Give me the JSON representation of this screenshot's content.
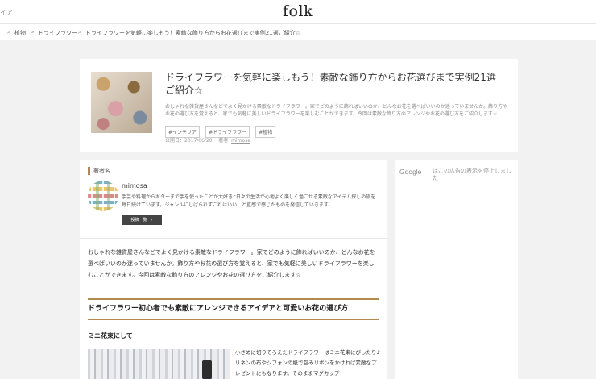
{
  "header": {
    "left_cut_text": "イア",
    "logo": "folk"
  },
  "breadcrumb": {
    "home": ">",
    "items": [
      "植物",
      "ドライフラワー",
      "ドライフラワーを気軽に楽しもう！素敵な飾り方からお花選びまで実例21選ご紹介☆"
    ],
    "separator": ">"
  },
  "article_card": {
    "title": "ドライフラワーを気軽に楽しもう！素敵な飾り方からお花選びまで実例21選ご紹介☆",
    "lead": "おしゃれな雑貨屋さんなどでよく見かける素敵なドライフラワー。家でどのように飾ればいいのか、どんなお花を選べばいいのか迷っていませんか。飾り方やお花の選び方を覚えると、家でも気軽に美しいドライフラワーを楽しむことができます。今回は素敵な飾り方のアレンジやお花の選び方をご紹介します☆",
    "tags": [
      "#インテリア",
      "#ドライフラワー",
      "#植物"
    ],
    "date_label": "公開日：2017/06/20",
    "author_label": "著者",
    "author_name": "mimosa"
  },
  "author_box": {
    "heading": "著者名",
    "name": "mimosa",
    "bio": "手芸や料理からギターまで手を使ったことが大好き♪日々の生活が心地よく楽しく過ごせる素敵なアイテム探しの旅を毎日続けています。ジャンルにしばられずこれはいい！と直感で感じたものを発信していきます。",
    "button_label": "投稿一覧",
    "button_icon": "chevron-right-icon"
  },
  "intro": "おしゃれな雑貨屋さんなどでよく見かける素敵なドライフラワー。家でどのように飾ればいいのか、どんなお花を選べばいいのか迷っていませんか。飾り方やお花の選び方を覚えると、家でも気軽に美しいドライフラワーを楽しむことができます。今回は素敵な飾り方のアレンジやお花の選び方をご紹介します☆",
  "section": {
    "h2": "ドライフラワー初心者でも素敵にアレンジできるアイデアと可愛いお花の選び方",
    "h3": "ミニ花束にして",
    "text": "小さめに切りそろえたドライフラワーはミニ花束にぴったり♪リネンの布やシフォンの紙で包みリボンをかければ素敵なプレゼントにもなります。そのままマグカップ"
  },
  "ad": {
    "google": "Google",
    "text": "はこの広告の表示を停止しました"
  },
  "colors": {
    "accent": "#b28a4a",
    "background": "#f2f2f2",
    "button": "#444444"
  }
}
